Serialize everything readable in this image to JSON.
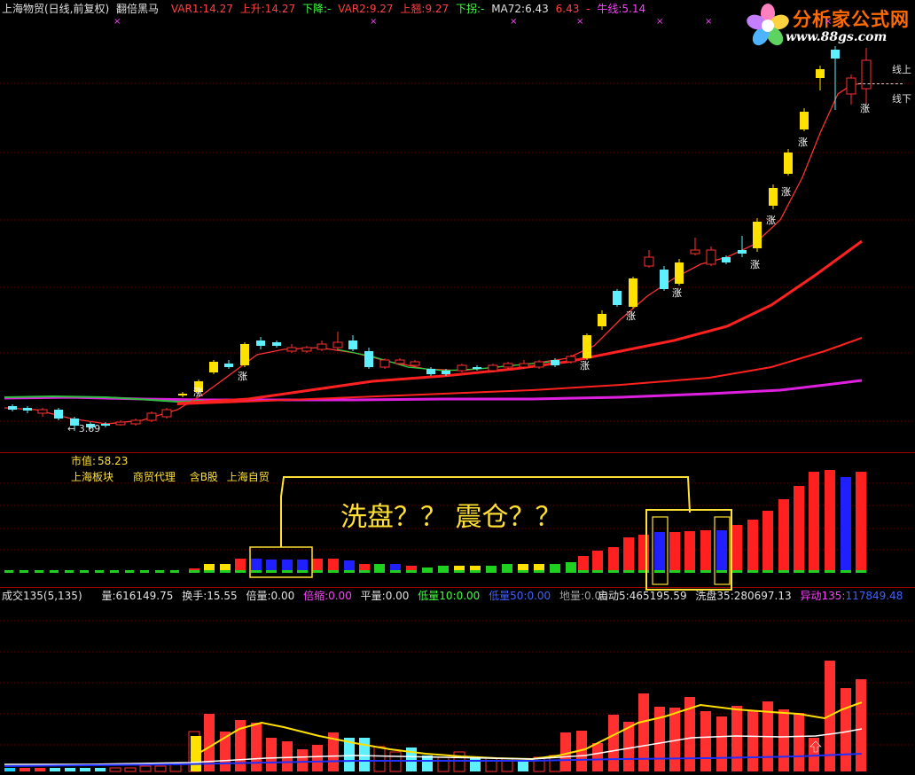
{
  "header": {
    "stock": "上海物贸(日线,前复权)",
    "indicator": "翻倍黑马",
    "var1_label": "VAR1:",
    "var1": "14.27",
    "up_label": "上升:",
    "up": "14.27",
    "down_label": "下降:",
    "down": "-",
    "var2_label": "VAR2:",
    "var2": "9.27",
    "jump_label": "上翘:",
    "jump": "9.27",
    "turn_label": "下拐:",
    "turn": "-",
    "ma72_label": "MA72:",
    "ma72": "6.43",
    "ma72b": "6.43",
    "ma72c": "-",
    "bull_label": "牛线:",
    "bull": "5.14"
  },
  "logo": {
    "title": "分析家公式网",
    "url": "www.88gs.com"
  },
  "price_panel": {
    "low_marker": "← 3.69",
    "right_upper": "线上",
    "right_lower": "线下",
    "up_mark": "涨"
  },
  "mid_panel": {
    "market_value_label": "市值:",
    "market_value": "58.23",
    "tags": [
      "上海板块",
      "商贸代理",
      "含B股",
      "上海自贸"
    ],
    "annotation": "洗盘？？  震仓？？"
  },
  "volume_info": {
    "title": "成交135(5,135)",
    "vol_label": "量:",
    "vol": "616149.75",
    "turnover_label": "换手:",
    "turnover": "15.55",
    "ratio_label": "倍量:",
    "ratio": "0.00",
    "shrink_label": "倍缩:",
    "shrink": "0.00",
    "flat_label": "平量:",
    "flat": "0.00",
    "low10_label": "低量10:",
    "low10": "0.00",
    "low50_label": "低量50:",
    "low50": "0.00",
    "ground_label": "地量:",
    "ground": "0.00",
    "start5_label": "启动5:",
    "start5": "465195.59",
    "wash35_label": "洗盘35:",
    "wash35": "280697.13",
    "abnormal_label": "异动135:",
    "abnormal": "117849.48"
  },
  "colors": {
    "red": "#ff2020",
    "yellow": "#ffe100",
    "cyan": "#5ff0ff",
    "magenta": "#ff30ff",
    "blue": "#2020ff",
    "green": "#20e020"
  }
}
